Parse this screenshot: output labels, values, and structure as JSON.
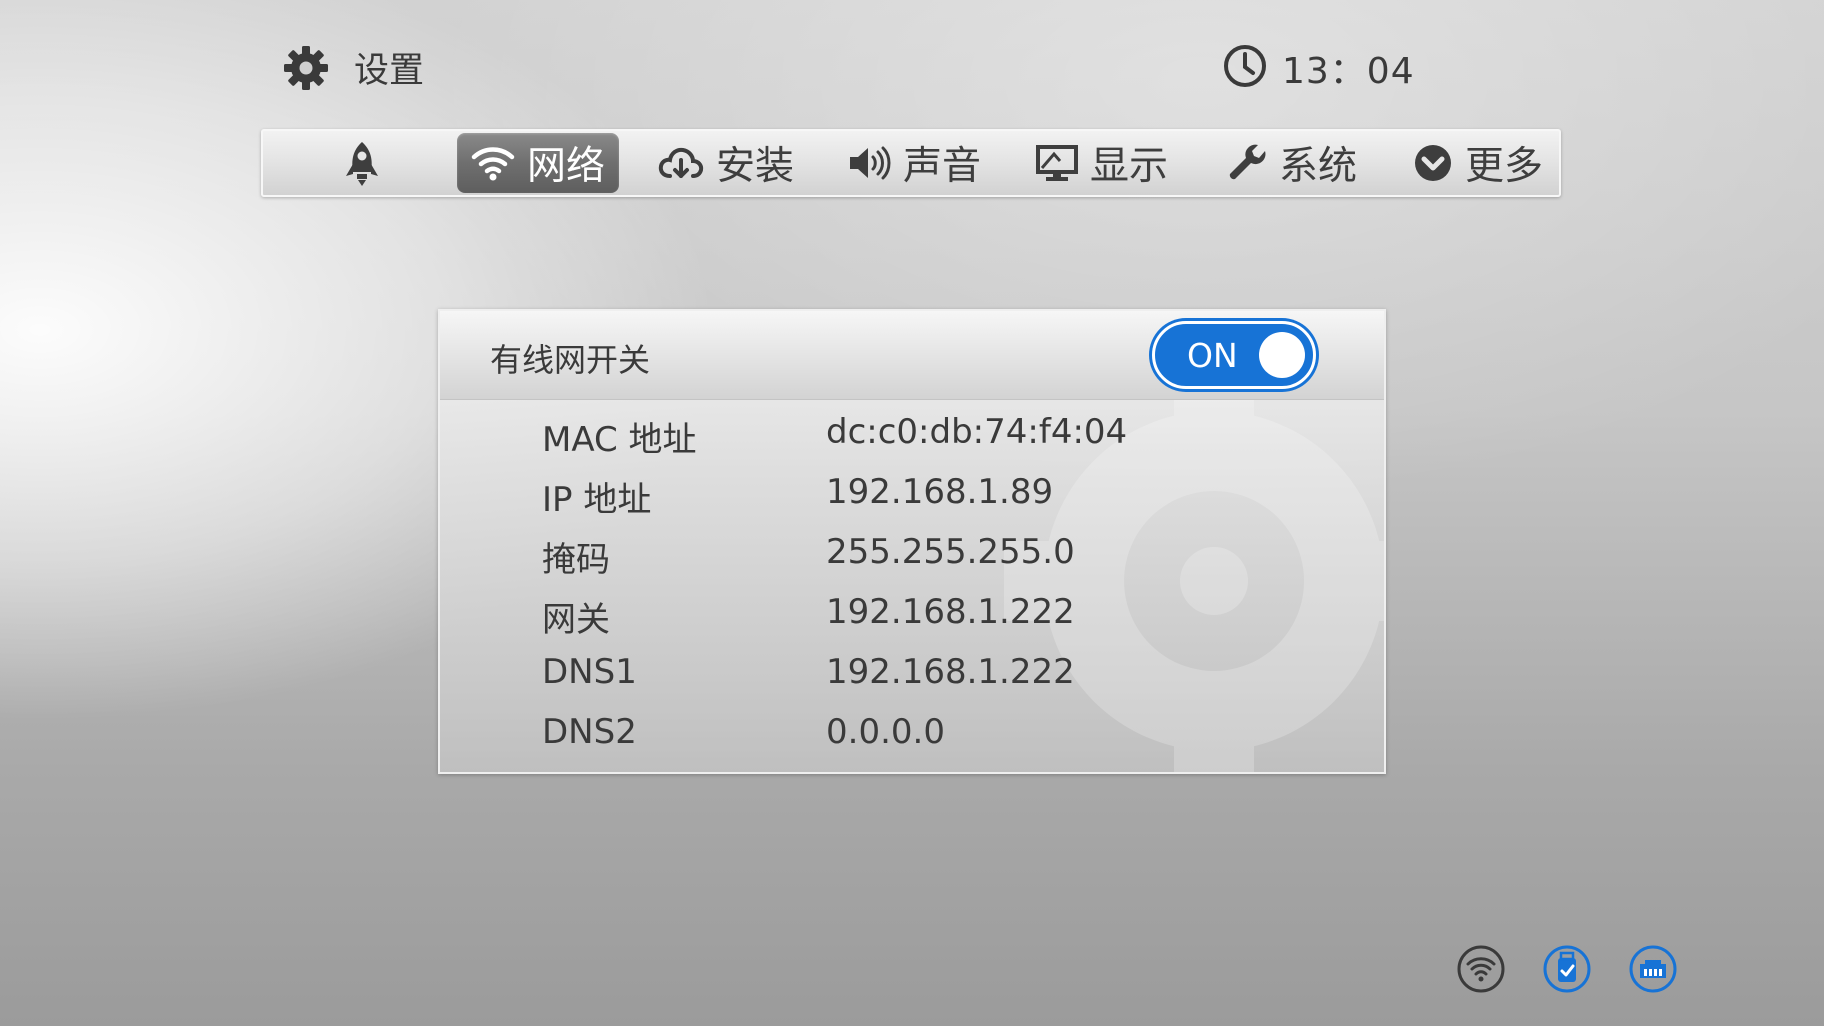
{
  "header": {
    "title": "设置",
    "time": "13：04",
    "icons": [
      "gear-icon",
      "clock-icon"
    ]
  },
  "tabs": [
    {
      "name": "home",
      "label": "",
      "icon": "rocket-icon",
      "active": false
    },
    {
      "name": "network",
      "label": "网络",
      "icon": "wifi-icon",
      "active": true
    },
    {
      "name": "install",
      "label": "安装",
      "icon": "cloud-download-icon",
      "active": false
    },
    {
      "name": "sound",
      "label": "声音",
      "icon": "speaker-icon",
      "active": false
    },
    {
      "name": "display",
      "label": "显示",
      "icon": "monitor-icon",
      "active": false
    },
    {
      "name": "system",
      "label": "系统",
      "icon": "wrench-icon",
      "active": false
    },
    {
      "name": "more",
      "label": "更多",
      "icon": "chevron-down-circle-icon",
      "active": false
    }
  ],
  "panel": {
    "wired_switch_label": "有线网开关",
    "toggle_state": "ON",
    "rows": [
      {
        "key": "MAC 地址",
        "value": "dc:c0:db:74:f4:04"
      },
      {
        "key": "IP 地址",
        "value": "192.168.1.89"
      },
      {
        "key": "掩码",
        "value": "255.255.255.0"
      },
      {
        "key": "网关",
        "value": "192.168.1.222"
      },
      {
        "key": "DNS1",
        "value": "192.168.1.222"
      },
      {
        "key": "DNS2",
        "value": "0.0.0.0"
      }
    ]
  },
  "status_bar": {
    "icons": [
      "wifi-status-icon",
      "usb-status-icon",
      "ethernet-status-icon"
    ]
  },
  "colors": {
    "accent": "#1773d6",
    "active_tab": "#6f6f6f",
    "text": "#3a3a3a"
  }
}
